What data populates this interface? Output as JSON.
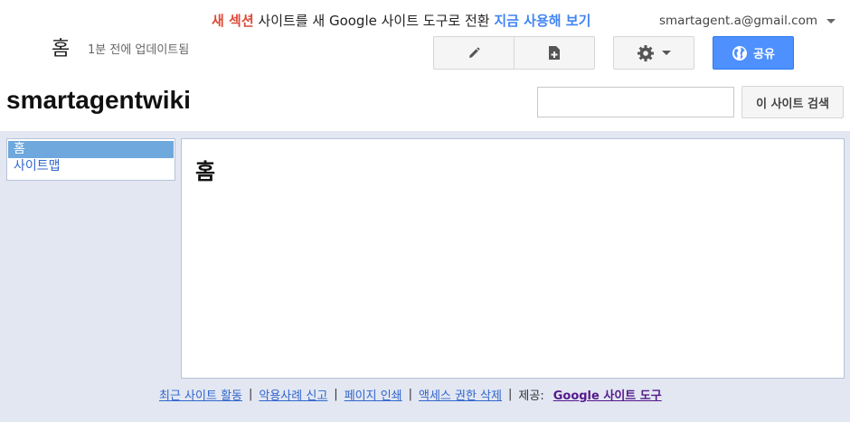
{
  "banner": {
    "new_label": "새 섹션",
    "message": "사이트를 새 Google 사이트 도구로 전환",
    "action_label": "지금 사용해 보기"
  },
  "account": {
    "email": "smartagent.a@gmail.com"
  },
  "page": {
    "name": "홈",
    "updated": "1분 전에 업데이트됨"
  },
  "toolbar": {
    "share_label": "공유"
  },
  "site": {
    "title": "smartagentwiki"
  },
  "search": {
    "placeholder": "",
    "button_label": "이 사이트 검색"
  },
  "sidebar": {
    "items": [
      {
        "label": "홈",
        "active": true
      },
      {
        "label": "사이트맵",
        "active": false
      }
    ]
  },
  "content": {
    "title": "홈"
  },
  "footer": {
    "links": [
      "최근 사이트 활동",
      "악용사례 신고",
      "페이지 인쇄",
      "액세스 권한 삭제"
    ],
    "powered_by": "제공:",
    "powered_link": "Google 사이트 도구"
  },
  "colors": {
    "accent": "#4d90fe",
    "banner_new": "#dd4b39",
    "banner_link": "#4285f4",
    "background": "#e2e7f2"
  },
  "icons": [
    "pencil-icon",
    "new-page-icon",
    "gear-icon",
    "globe-icon",
    "chevron-down-icon"
  ]
}
